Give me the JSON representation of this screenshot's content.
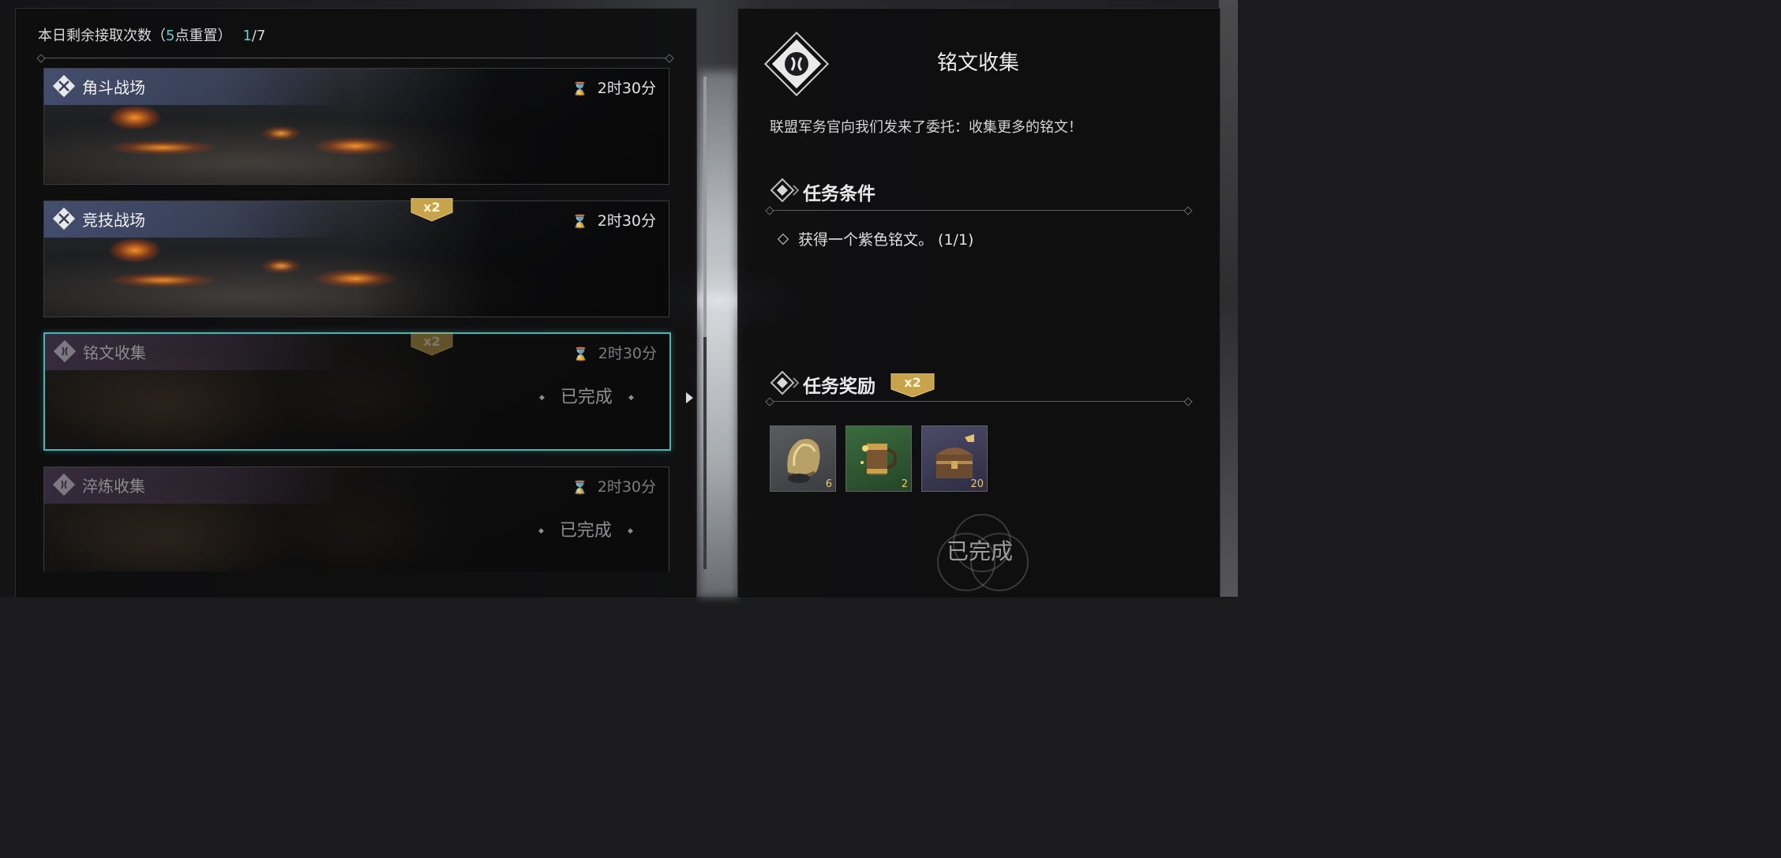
{
  "quota": {
    "prefix": "本日剩余接取次数（",
    "reset_hour": "5",
    "suffix": "点重置）",
    "used": "1",
    "total": "/7"
  },
  "missions": [
    {
      "title": "角斗战场",
      "timer": "2时30分",
      "double": false,
      "completed": false,
      "selected": false,
      "theme": "fire"
    },
    {
      "title": "竞技战场",
      "timer": "2时30分",
      "double": true,
      "badge": "x2",
      "completed": false,
      "selected": false,
      "theme": "fire"
    },
    {
      "title": "铭文收集",
      "timer": "2时30分",
      "double": true,
      "badge": "x2",
      "completed": true,
      "status": "已完成",
      "selected": true,
      "theme": "forge"
    },
    {
      "title": "淬炼收集",
      "timer": "2时30分",
      "double": false,
      "completed": true,
      "status": "已完成",
      "selected": false,
      "theme": "forge"
    }
  ],
  "detail": {
    "title": "铭文收集",
    "description": "联盟军务官向我们发来了委托：收集更多的铭文！",
    "conditions_heading": "任务条件",
    "conditions": [
      {
        "text": "获得一个紫色铭文。 (1/1)"
      }
    ],
    "rewards_heading": "任务奖励",
    "rewards_badge": "x2",
    "rewards": [
      {
        "icon": "gold-armor-icon",
        "qty": "6"
      },
      {
        "icon": "tankard-icon",
        "qty": "2"
      },
      {
        "icon": "treasure-chest-icon",
        "qty": "20"
      }
    ],
    "status": "已完成"
  },
  "colors": {
    "accent_teal": "#49b5b2",
    "quota_highlight": "#5fd0cf",
    "badge_gold": "#c9a34a",
    "reward_qty": "#f0c864"
  }
}
